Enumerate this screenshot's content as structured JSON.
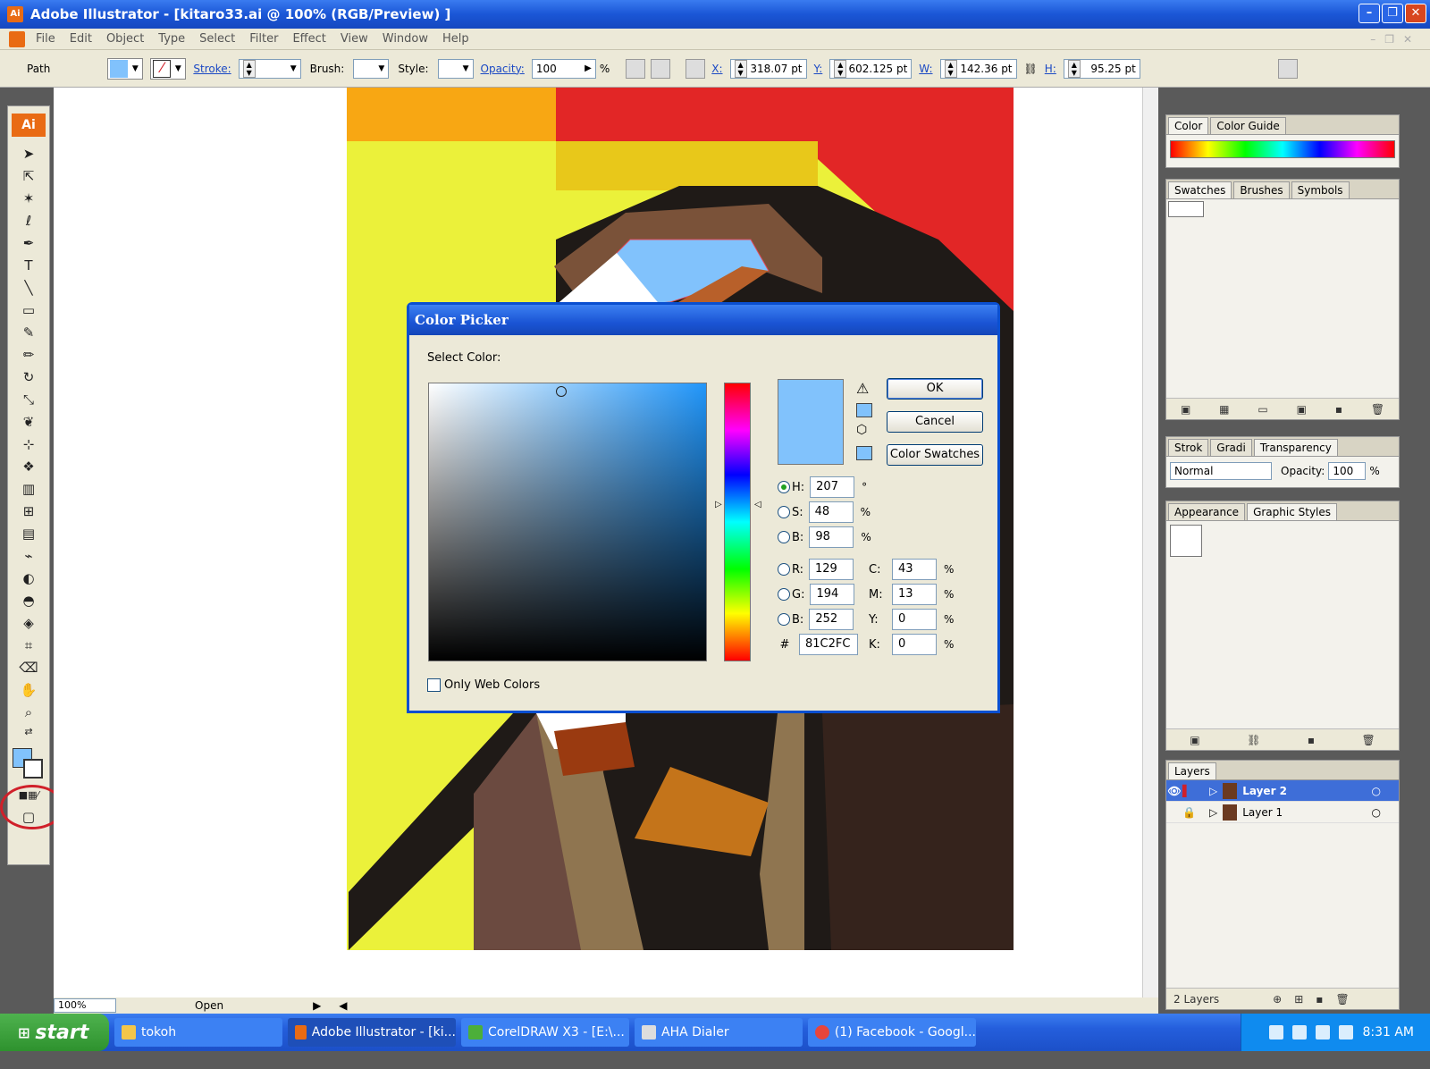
{
  "window": {
    "title": "Adobe Illustrator - [kitaro33.ai @ 100% (RGB/Preview) ]",
    "app_icon": "Ai"
  },
  "menu": [
    "File",
    "Edit",
    "Object",
    "Type",
    "Select",
    "Filter",
    "Effect",
    "View",
    "Window",
    "Help"
  ],
  "control_bar": {
    "selection": "Path",
    "stroke_label": "Stroke:",
    "brush_label": "Brush:",
    "style_label": "Style:",
    "opacity_label": "Opacity:",
    "opacity_value": "100",
    "opacity_unit": "%",
    "x_label": "X:",
    "x_value": "318.07 pt",
    "y_label": "Y:",
    "y_value": "602.125 pt",
    "w_label": "W:",
    "w_value": "142.36 pt",
    "h_label": "H:",
    "h_value": "95.25 pt"
  },
  "tools": {
    "logo": "Ai"
  },
  "status": {
    "zoom": "100%",
    "text": "Open"
  },
  "dialog": {
    "title": "Color Picker",
    "select_label": "Select Color:",
    "ok": "OK",
    "cancel": "Cancel",
    "swatches": "Color Swatches",
    "selected_color": "#81C2FC",
    "h_label": "H:",
    "h": "207",
    "h_unit": "°",
    "s_label": "S:",
    "s": "48",
    "s_unit": "%",
    "bri_label": "B:",
    "bri": "98",
    "bri_unit": "%",
    "r_label": "R:",
    "r": "129",
    "g_label": "G:",
    "g": "194",
    "b_label": "B:",
    "b": "252",
    "hex_label": "#",
    "hex": "81C2FC",
    "c_label": "C:",
    "c": "43",
    "c_unit": "%",
    "m_label": "M:",
    "m": "13",
    "m_unit": "%",
    "y_label": "Y:",
    "y": "0",
    "y_unit": "%",
    "k_label": "K:",
    "k": "0",
    "k_unit": "%",
    "web_only": "Only Web Colors"
  },
  "panels": {
    "color": {
      "tabs": [
        "Color",
        "Color Guide"
      ]
    },
    "swatches": {
      "tabs": [
        "Swatches",
        "Brushes",
        "Symbols"
      ]
    },
    "transparency": {
      "tabs": [
        "Strok",
        "Gradi",
        "Transparency"
      ],
      "blend_mode": "Normal",
      "opacity_label": "Opacity:",
      "opacity": "100",
      "unit": "%"
    },
    "appearance": {
      "tabs": [
        "Appearance",
        "Graphic Styles"
      ]
    },
    "layers": {
      "tab": "Layers",
      "items": [
        "Layer 2",
        "Layer 1"
      ],
      "count": "2 Layers"
    }
  },
  "taskbar": {
    "start": "start",
    "tasks": [
      "tokoh",
      "Adobe Illustrator - [ki...",
      "CorelDRAW X3 - [E:\\...",
      "AHA Dialer",
      "(1) Facebook - Googl..."
    ],
    "clock": "8:31 AM"
  },
  "colors": {
    "accent": "#81c2fc",
    "title_blue": "#1a56d6",
    "highlight_ring": "#d0202a"
  }
}
